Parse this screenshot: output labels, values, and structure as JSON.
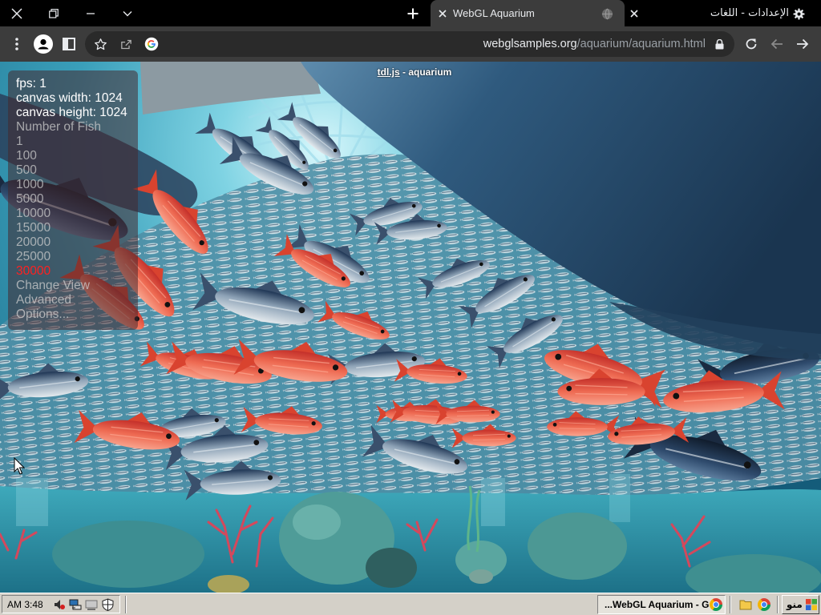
{
  "tabs": [
    {
      "title": "WebGL Aquarium",
      "active": true
    },
    {
      "title": "الإعدادات - اللغات",
      "active": false
    }
  ],
  "address_bar": {
    "host": "webglsamples.org",
    "path": "/aquarium/aquarium.html"
  },
  "page": {
    "header_link": "tdl.js",
    "header_suffix": " - aquarium",
    "stats": {
      "fps": "fps: 1",
      "canvas_width": "canvas width: 1024",
      "canvas_height": "canvas height: 1024"
    },
    "fish_menu": {
      "label": "Number of Fish",
      "options": [
        "1",
        "100",
        "500",
        "1000",
        "5000",
        "10000",
        "15000",
        "20000",
        "25000",
        "30000"
      ],
      "selected": "30000"
    },
    "menu_items": {
      "change_view": "Change View",
      "advanced": "Advanced",
      "options": "Options..."
    }
  },
  "taskbar": {
    "clock": "AM 3:48",
    "task_button": "...WebGL Aquarium - G",
    "start_label": "منو"
  },
  "icons": [
    "close-icon",
    "restore-icon",
    "minimize-icon",
    "chevron-down-icon",
    "plus-icon",
    "globe-icon",
    "gear-icon",
    "kebab-menu-icon",
    "profile-icon",
    "side-panel-icon",
    "star-icon",
    "share-icon",
    "google-icon",
    "lock-icon",
    "reload-icon",
    "back-arrow-icon",
    "forward-arrow-icon",
    "speaker-icon",
    "network-icon",
    "shield-icon",
    "folder-icon",
    "chrome-icon",
    "windows-logo-icon",
    "mouse-cursor"
  ],
  "colors": {
    "tab_strip": "#000000",
    "toolbar": "#3c3c3c",
    "selected_option": "#ff2020",
    "taskbar": "#d4d0c8",
    "water": "#2f9bb8"
  }
}
